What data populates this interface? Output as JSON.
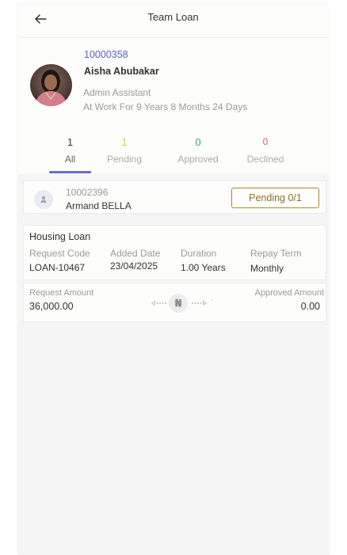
{
  "header": {
    "title": "Team Loan"
  },
  "profile": {
    "staff_id": "10000358",
    "name": "Aisha Abubakar",
    "role": "Admin Assistant",
    "tenure": "At Work For 9 Years 8 Months 24 Days"
  },
  "tabs": [
    {
      "label": "All",
      "count": "1",
      "active": true
    },
    {
      "label": "Pending",
      "count": "1"
    },
    {
      "label": "Approved",
      "count": "0"
    },
    {
      "label": "Declined",
      "count": "0"
    }
  ],
  "employee": {
    "id": "10002396",
    "name": "Armand BELLA",
    "status": "Pending 0/1"
  },
  "loan": {
    "type": "Housing Loan",
    "fields": [
      {
        "label": "Request Code",
        "value": "LOAN-10467"
      },
      {
        "label": "Added Date",
        "value": "23/04/2025"
      },
      {
        "label": "Duration",
        "value": "1.00 Years"
      },
      {
        "label": "Repay Term",
        "value": "Monthly"
      }
    ],
    "request_amount_label": "Request Amount",
    "request_amount": "36,000.00",
    "approved_amount_label": "Approved Amount",
    "approved_amount": "0.00",
    "currency_symbol": "₦"
  },
  "colors": {
    "accent": "#5b5fc7",
    "pending": "#e3c83a",
    "approved": "#3fae5b",
    "declined": "#e05a5a",
    "pending_button": "#a88a28"
  }
}
